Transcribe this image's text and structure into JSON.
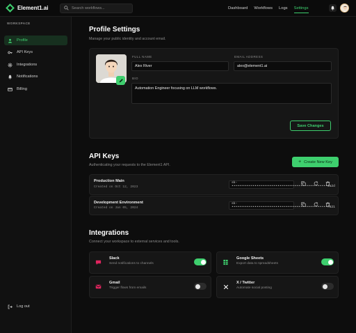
{
  "brand": {
    "name": "Element1.ai",
    "accent": "#3ecf6e"
  },
  "search": {
    "placeholder": "Search workflows..."
  },
  "nav": {
    "items": [
      "Dashboard",
      "Workflows",
      "Logs",
      "Settings"
    ],
    "active": "Settings"
  },
  "sidebar": {
    "section_label": "WORKSPACE",
    "items": [
      {
        "label": "Profile",
        "icon": "user-icon",
        "active": true
      },
      {
        "label": "API Keys",
        "icon": "key-icon",
        "active": false
      },
      {
        "label": "Integrations",
        "icon": "puzzle-icon",
        "active": false
      },
      {
        "label": "Notifications",
        "icon": "bell-icon",
        "active": false
      },
      {
        "label": "Billing",
        "icon": "card-icon",
        "active": false
      }
    ],
    "logout_label": "Log out"
  },
  "profile": {
    "title": "Profile Settings",
    "subtitle": "Manage your public identity and account email.",
    "full_name_label": "FULL NAME",
    "full_name": "Alex River",
    "email_label": "EMAIL ADDRESS",
    "email": "alex@element1.ai",
    "bio_label": "BIO",
    "bio": "Automation Engineer focusing on LLM workflows.",
    "save_label": "Save Changes"
  },
  "api_keys": {
    "title": "API Keys",
    "subtitle": "Authenticating your requests to the Element1 API.",
    "create_label": "Create New Key",
    "keys": [
      {
        "name": "Production Main",
        "created": "Created on Oct 12, 2023",
        "value": "sk-••••••••••••••••••••••••••••••••••••••••••••••••••4a2d"
      },
      {
        "name": "Development Environment",
        "created": "Created on Jan 05, 2024",
        "value": "sk-••••••••••••••••••••••••••••••••••••••••••••••••••f821"
      }
    ]
  },
  "integrations": {
    "title": "Integrations",
    "subtitle": "Connect your workspace to external services and tools.",
    "items": [
      {
        "name": "Slack",
        "desc": "Send notifications to channels",
        "icon": "slack-icon",
        "enabled": true,
        "color": "#e0245e"
      },
      {
        "name": "Google Sheets",
        "desc": "Export data to spreadsheets",
        "icon": "sheets-icon",
        "enabled": true,
        "color": "#3ecf6e"
      },
      {
        "name": "Gmail",
        "desc": "Trigger flows from emails",
        "icon": "gmail-icon",
        "enabled": false,
        "color": "#e0245e"
      },
      {
        "name": "X / Twitter",
        "desc": "Automate social posting",
        "icon": "x-icon",
        "enabled": false,
        "color": "#ffffff"
      }
    ]
  }
}
